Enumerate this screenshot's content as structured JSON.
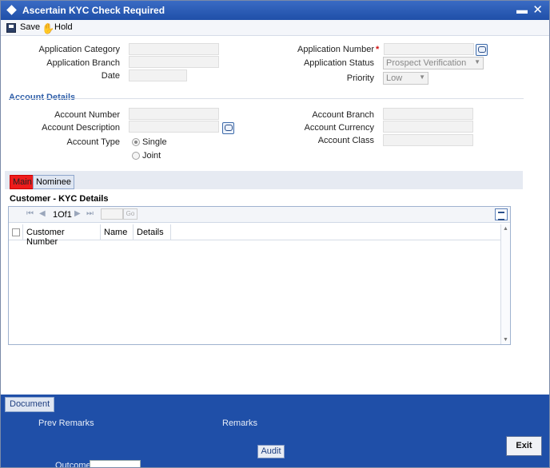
{
  "window": {
    "title": "Ascertain KYC Check Required",
    "minimize": "▬",
    "close": "✕"
  },
  "toolbar": {
    "save_label": "Save",
    "hold_label": "Hold"
  },
  "header": {
    "application_category_label": "Application Category",
    "application_branch_label": "Application Branch",
    "date_label": "Date",
    "application_number_label": "Application Number",
    "required_marker": "*",
    "application_status_label": "Application Status",
    "application_status_value": "Prospect Verification",
    "priority_label": "Priority",
    "priority_value": "Low"
  },
  "account_details": {
    "section_title": "Account Details",
    "account_number_label": "Account Number",
    "account_description_label": "Account Description",
    "account_type_label": "Account Type",
    "account_type_options": [
      "Single",
      "Joint"
    ],
    "account_type_selected": "Single",
    "account_branch_label": "Account Branch",
    "account_currency_label": "Account Currency",
    "account_class_label": "Account Class"
  },
  "tabs": [
    {
      "label": "Main",
      "active": true
    },
    {
      "label": "Nominee",
      "active": false
    }
  ],
  "kyc_grid": {
    "title": "Customer - KYC Details",
    "page_info": "1Of1",
    "go_label": "Go",
    "columns": [
      "Customer Number",
      "Name",
      "Details"
    ],
    "rows": []
  },
  "footer": {
    "document_button": "Document",
    "prev_remarks_label": "Prev Remarks",
    "remarks_label": "Remarks",
    "audit_button": "Audit",
    "exit_button": "Exit",
    "outcome_label": "Outcome"
  },
  "colors": {
    "title_bar": "#1f4fa8",
    "active_tab": "#ee1c1c",
    "section_title": "#2d5da8",
    "required": "#d01010"
  }
}
